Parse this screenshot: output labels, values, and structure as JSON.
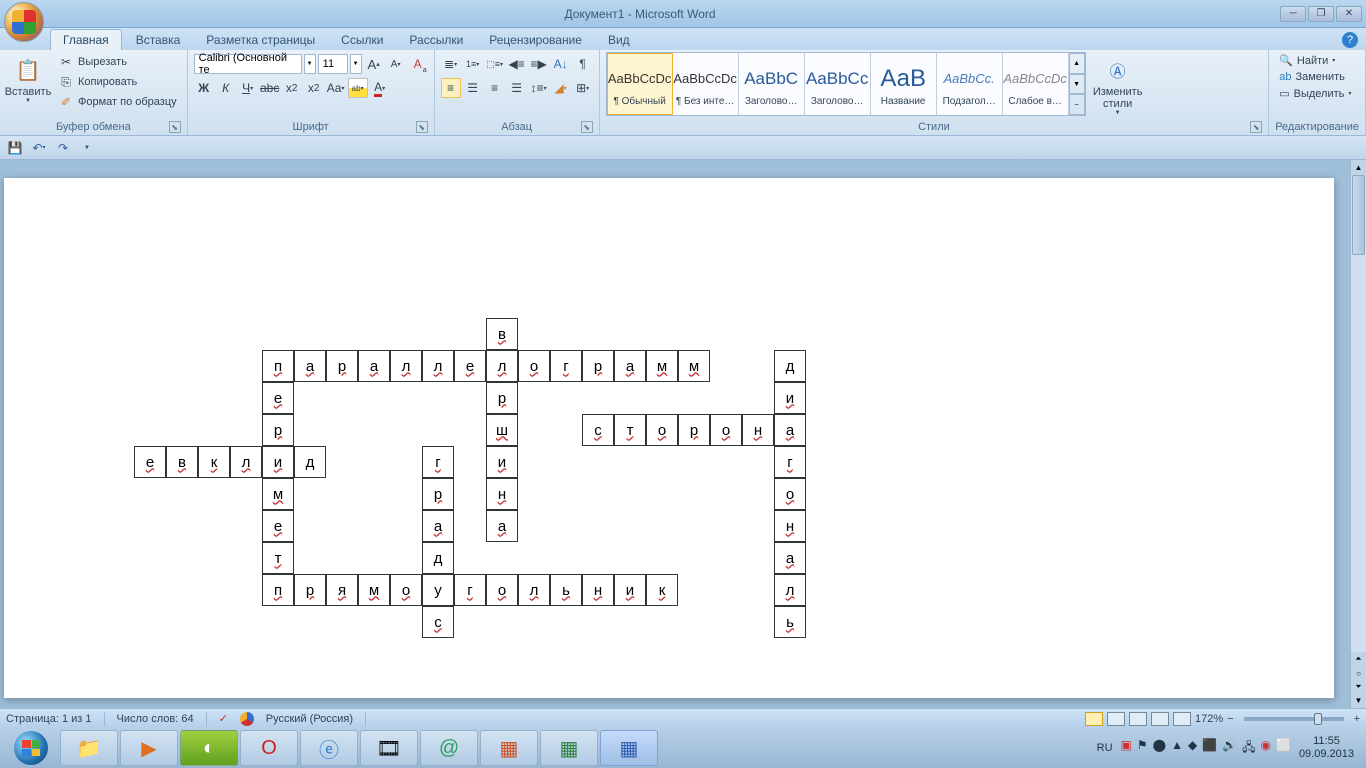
{
  "title": "Документ1 - Microsoft Word",
  "tabs": [
    "Главная",
    "Вставка",
    "Разметка страницы",
    "Ссылки",
    "Рассылки",
    "Рецензирование",
    "Вид"
  ],
  "active_tab": 0,
  "clipboard": {
    "paste": "Вставить",
    "cut": "Вырезать",
    "copy": "Копировать",
    "format": "Формат по образцу",
    "label": "Буфер обмена"
  },
  "font": {
    "name": "Calibri (Основной те",
    "size": "11",
    "label": "Шрифт",
    "bold": "Ж",
    "italic": "К",
    "underline": "Ч",
    "strike": "abc"
  },
  "paragraph": {
    "label": "Абзац"
  },
  "styles": {
    "label": "Стили",
    "change": "Изменить стили",
    "items": [
      {
        "preview": "AaBbCcDc",
        "name": "¶ Обычный",
        "sel": true,
        "color": "#333"
      },
      {
        "preview": "AaBbCcDc",
        "name": "¶ Без инте…",
        "sel": false,
        "color": "#333"
      },
      {
        "preview": "AaBbC",
        "name": "Заголово…",
        "sel": false,
        "color": "#2a5a9a",
        "big": true
      },
      {
        "preview": "AaBbCc",
        "name": "Заголово…",
        "sel": false,
        "color": "#2a5a9a",
        "big": true
      },
      {
        "preview": "АаВ",
        "name": "Название",
        "sel": false,
        "color": "#2a5a9a",
        "huge": true
      },
      {
        "preview": "AaBbCc.",
        "name": "Подзагол…",
        "sel": false,
        "color": "#4a7aba",
        "it": true
      },
      {
        "preview": "AaBbCcDc",
        "name": "Слабое в…",
        "sel": false,
        "color": "#888",
        "it": true
      }
    ]
  },
  "editing": {
    "find": "Найти",
    "replace": "Заменить",
    "select": "Выделить",
    "label": "Редактирование"
  },
  "status": {
    "page": "Страница: 1 из 1",
    "words": "Число слов: 64",
    "lang": "Русский (Россия)",
    "zoom": "172%"
  },
  "taskbar": {
    "lang": "RU",
    "time": "11:55",
    "date": "09.09.2013"
  },
  "crossword": {
    "rows": [
      [
        null,
        null,
        null,
        null,
        null,
        null,
        null,
        null,
        null,
        null,
        null,
        "в",
        null,
        null,
        null,
        null,
        null,
        null,
        null,
        null,
        null,
        null
      ],
      [
        null,
        null,
        null,
        null,
        "п",
        "а",
        "р",
        "а",
        "л",
        "л",
        "е",
        "л",
        "о",
        "г",
        "р",
        "а",
        "м",
        "м",
        null,
        null,
        "д",
        null
      ],
      [
        null,
        null,
        null,
        null,
        "е",
        null,
        null,
        null,
        null,
        null,
        null,
        "р",
        null,
        null,
        null,
        null,
        null,
        null,
        null,
        null,
        "и",
        null
      ],
      [
        null,
        null,
        null,
        null,
        "р",
        null,
        null,
        null,
        null,
        null,
        null,
        "ш",
        null,
        null,
        "с",
        "т",
        "о",
        "р",
        "о",
        "н",
        "а",
        null
      ],
      [
        "е",
        "в",
        "к",
        "л",
        "и",
        "д",
        null,
        null,
        null,
        "г",
        null,
        "и",
        null,
        null,
        null,
        null,
        null,
        null,
        null,
        null,
        "г",
        null
      ],
      [
        null,
        null,
        null,
        null,
        "м",
        null,
        null,
        null,
        null,
        "р",
        null,
        "н",
        null,
        null,
        null,
        null,
        null,
        null,
        null,
        null,
        "о",
        null
      ],
      [
        null,
        null,
        null,
        null,
        "е",
        null,
        null,
        null,
        null,
        "а",
        null,
        "а",
        null,
        null,
        null,
        null,
        null,
        null,
        null,
        null,
        "н",
        null
      ],
      [
        null,
        null,
        null,
        null,
        "т",
        null,
        null,
        null,
        null,
        "д",
        null,
        null,
        null,
        null,
        null,
        null,
        null,
        null,
        null,
        null,
        "а",
        null
      ],
      [
        null,
        null,
        null,
        null,
        "п",
        "р",
        "я",
        "м",
        "о",
        "у",
        "г",
        "о",
        "л",
        "ь",
        "н",
        "и",
        "к",
        null,
        null,
        null,
        "л",
        null
      ],
      [
        null,
        null,
        null,
        null,
        null,
        null,
        null,
        null,
        null,
        "с",
        null,
        null,
        null,
        null,
        null,
        null,
        null,
        null,
        null,
        null,
        "ь",
        null
      ]
    ],
    "underline": [
      "п",
      "р",
      "д",
      "г",
      "е",
      "т",
      "ь",
      "м",
      "а",
      "о",
      "с",
      "л",
      "н",
      "и",
      "к",
      "ш",
      "я",
      "в"
    ]
  }
}
